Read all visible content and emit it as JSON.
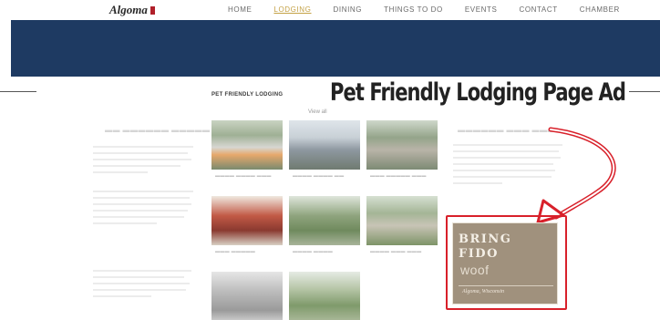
{
  "site": {
    "logo_text": "Algoma"
  },
  "nav": {
    "items": [
      "HOME",
      "LODGING",
      "DINING",
      "THINGS TO DO",
      "EVENTS",
      "CONTACT",
      "CHAMBER"
    ],
    "active_index": 1
  },
  "main": {
    "section_title": "PET FRIENDLY LODGING",
    "view_all": "View all"
  },
  "annotation": {
    "caption": "Pet Friendly Lodging Page Ad"
  },
  "ad": {
    "line1": "BRING",
    "line2": "FIDO",
    "line3": "woof",
    "script": "Algoma, Wisconsin"
  },
  "colors": {
    "banner": "#1e3a62",
    "annotation_red": "#d8202a",
    "ad_background": "#a0917d",
    "active_nav": "#c4a246"
  }
}
